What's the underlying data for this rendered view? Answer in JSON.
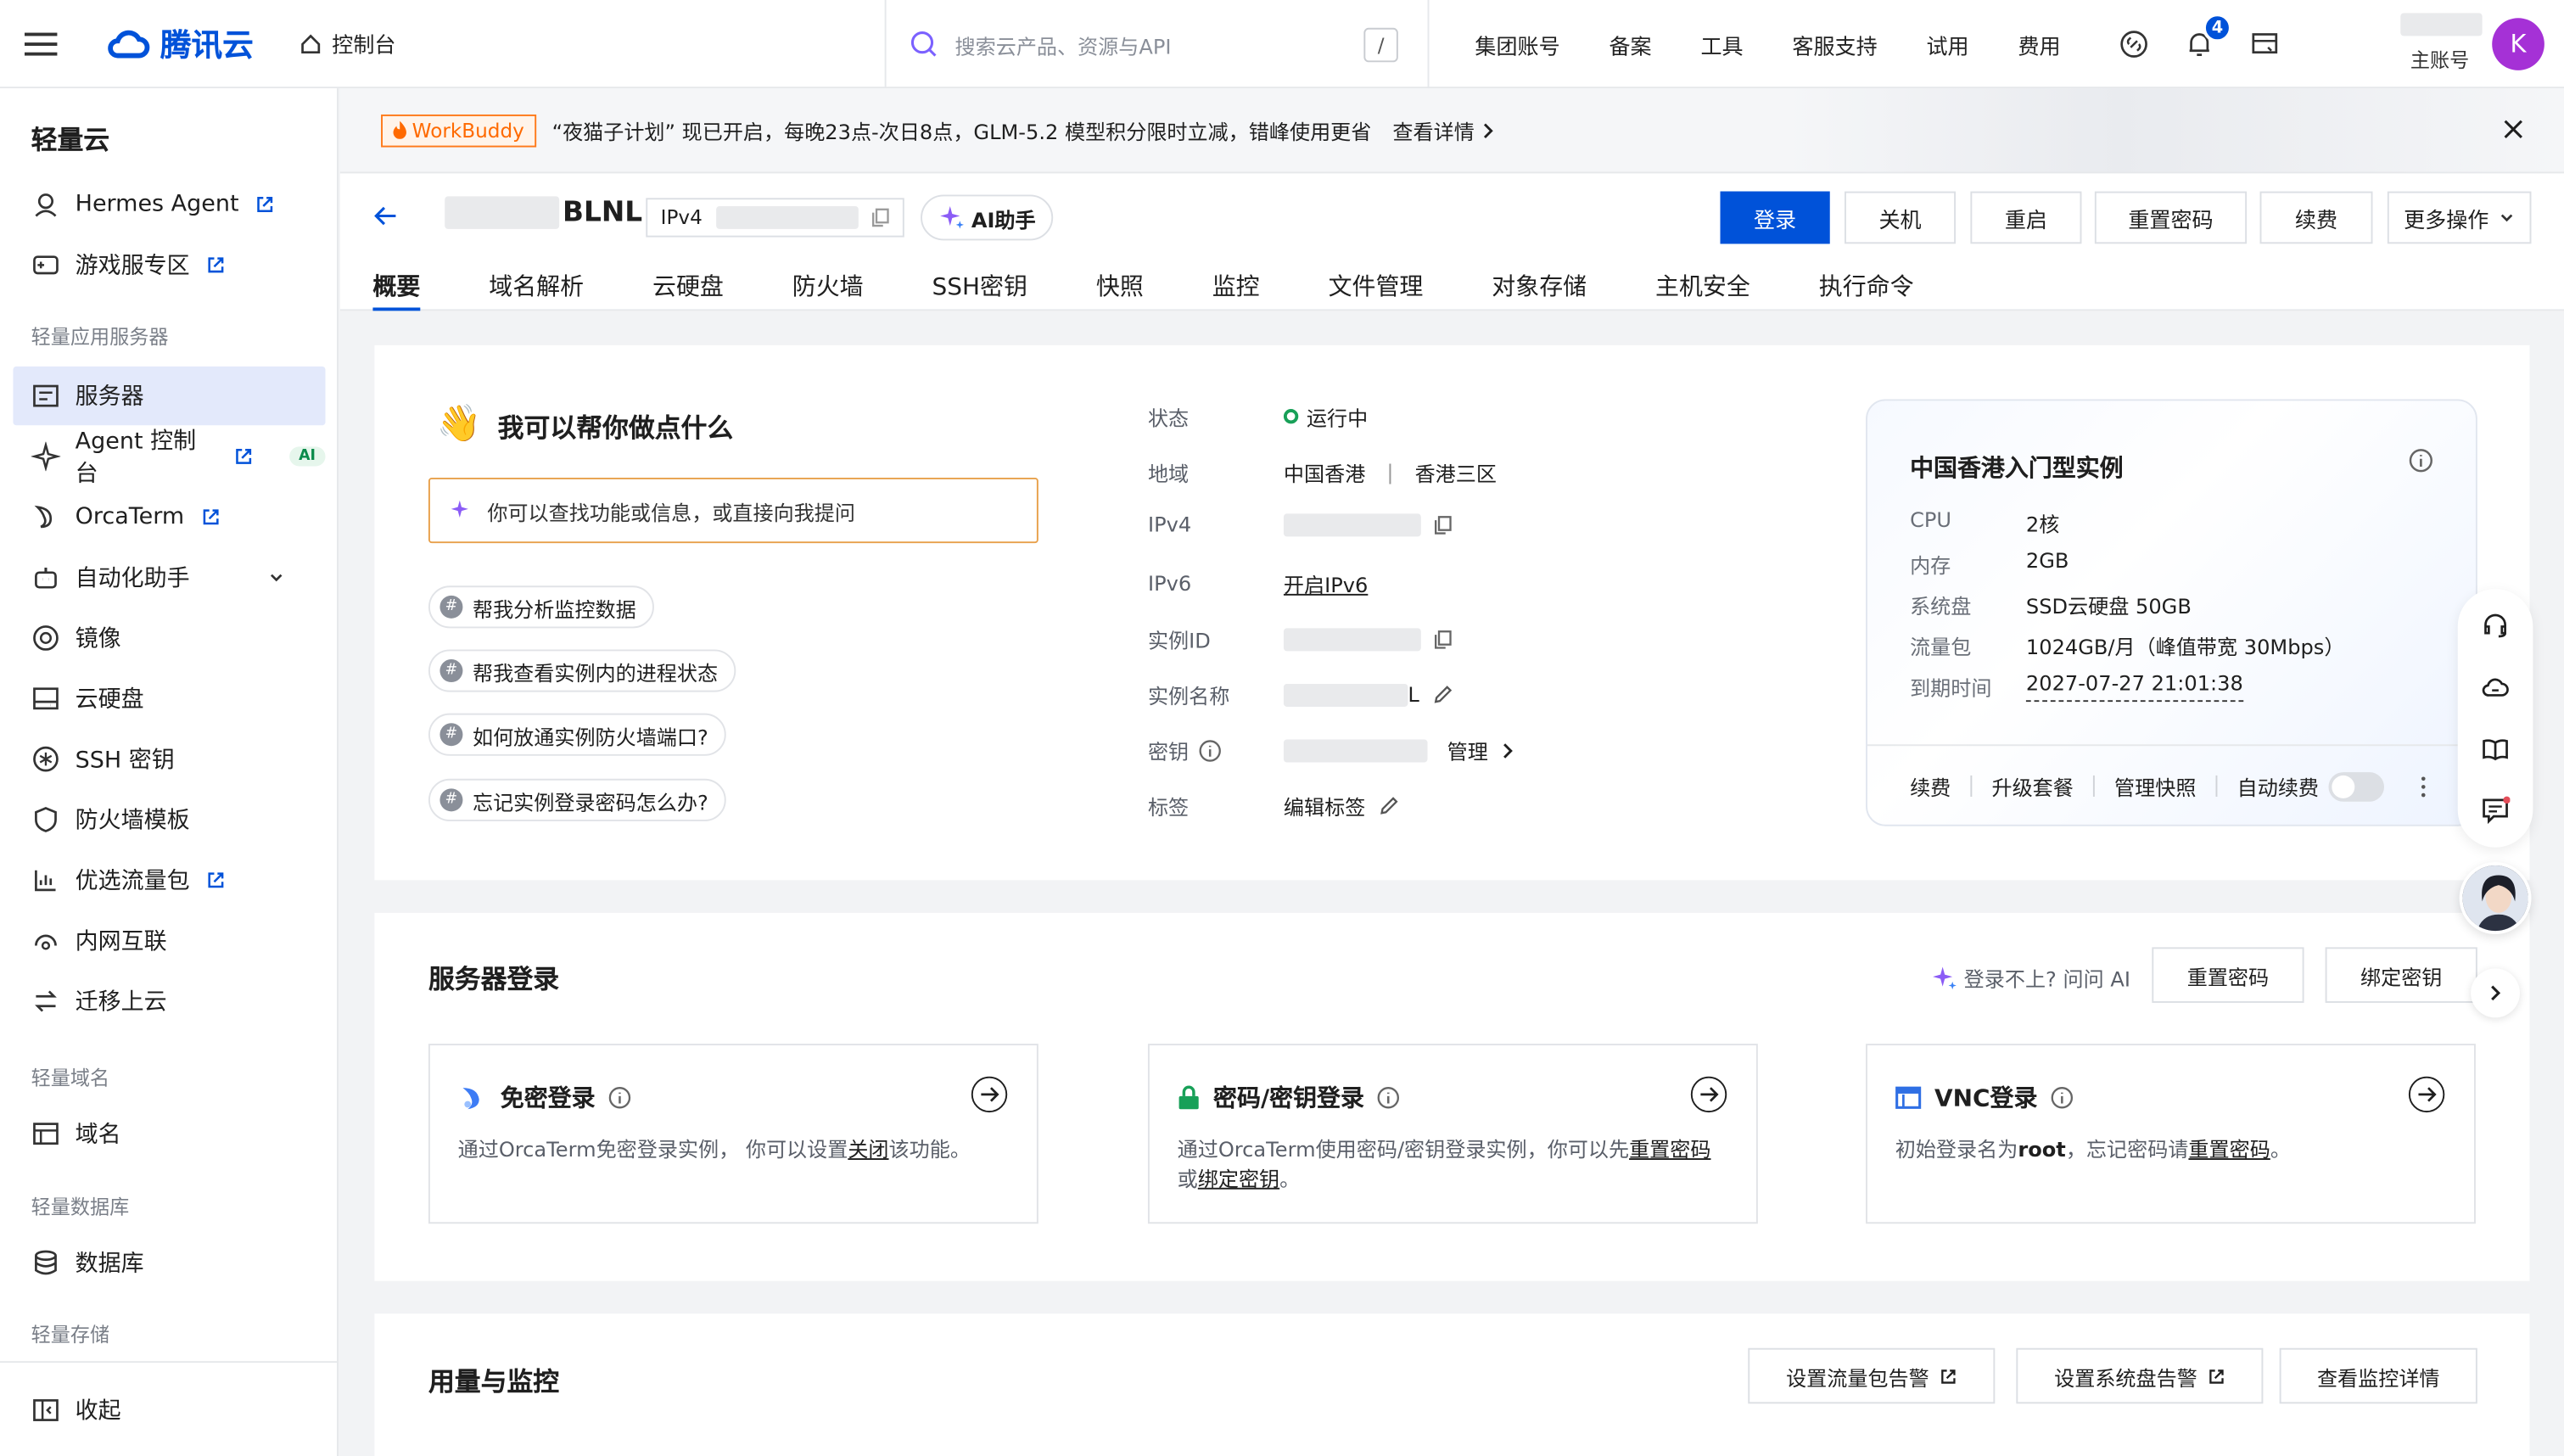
{
  "topbar": {
    "brand": "腾讯云",
    "console": "控制台",
    "search_placeholder": "搜索云产品、资源与API",
    "search_key": "/",
    "nav": [
      "集团账号",
      "备案",
      "工具",
      "客服支持",
      "试用",
      "费用"
    ],
    "notification_count": "4",
    "main_account": "主账号",
    "avatar_letter": "K"
  },
  "sidebar": {
    "title": "轻量云",
    "items_top": [
      {
        "label": "Hermes Agent",
        "icon": "agent-icon",
        "external": true
      },
      {
        "label": "游戏服专区",
        "icon": "gamepad-icon",
        "external": true
      }
    ],
    "section_app": "轻量应用服务器",
    "items_app": [
      {
        "label": "服务器",
        "icon": "server-icon",
        "active": true
      },
      {
        "label": "Agent 控制台",
        "icon": "sparkle-icon",
        "external": true,
        "tag": "AI"
      },
      {
        "label": "OrcaTerm",
        "icon": "orca-icon",
        "external": true
      },
      {
        "label": "自动化助手",
        "icon": "robot-icon",
        "expandable": true
      },
      {
        "label": "镜像",
        "icon": "image-icon"
      },
      {
        "label": "云硬盘",
        "icon": "disk-icon"
      },
      {
        "label": "SSH 密钥",
        "icon": "key-icon"
      },
      {
        "label": "防火墙模板",
        "icon": "shield-icon"
      },
      {
        "label": "优选流量包",
        "icon": "chart-icon",
        "external": true
      },
      {
        "label": "内网互联",
        "icon": "network-icon"
      },
      {
        "label": "迁移上云",
        "icon": "migrate-icon"
      }
    ],
    "section_domain": "轻量域名",
    "items_domain": [
      {
        "label": "域名",
        "icon": "domain-icon"
      }
    ],
    "section_db": "轻量数据库",
    "items_db": [
      {
        "label": "数据库",
        "icon": "database-icon"
      }
    ],
    "section_storage": "轻量存储",
    "collapse": "收起"
  },
  "banner": {
    "tag": "WorkBuddy",
    "text": "“夜猫子计划” 现已开启，每晚23点-次日8点，GLM-5.2 模型积分限时立减，错峰使用更省",
    "link": "查看详情"
  },
  "header": {
    "instance_suffix": "BLNL",
    "ip_type": "IPv4",
    "ai_assistant": "AI助手",
    "buttons": {
      "login": "登录",
      "shutdown": "关机",
      "restart": "重启",
      "reset_password": "重置密码",
      "renew": "续费",
      "more": "更多操作"
    },
    "tabs": [
      "概要",
      "域名解析",
      "云硬盘",
      "防火墙",
      "SSH密钥",
      "快照",
      "监控",
      "文件管理",
      "对象存储",
      "主机安全",
      "执行命令"
    ]
  },
  "overview": {
    "help_title": "我可以帮你做点什么",
    "help_placeholder": "你可以查找功能或信息，或直接向我提问",
    "suggestions": [
      "帮我分析监控数据",
      "帮我查看实例内的进程状态",
      "如何放通实例防火墙端口?",
      "忘记实例登录密码怎么办?"
    ],
    "info": {
      "status_label": "状态",
      "status_value": "运行中",
      "region_label": "地域",
      "region_value": "中国香港",
      "zone_value": "香港三区",
      "ipv4_label": "IPv4",
      "ipv6_label": "IPv6",
      "ipv6_action": "开启IPv6",
      "instance_id_label": "实例ID",
      "instance_name_label": "实例名称",
      "instance_name_tail": "L",
      "key_label": "密钥",
      "key_action": "管理",
      "tag_label": "标签",
      "tag_action": "编辑标签"
    },
    "spec": {
      "title": "中国香港入门型实例",
      "rows": [
        {
          "label": "CPU",
          "value": "2核"
        },
        {
          "label": "内存",
          "value": "2GB"
        },
        {
          "label": "系统盘",
          "value": "SSD云硬盘 50GB"
        },
        {
          "label": "流量包",
          "value": "1024GB/月（峰值带宽 30Mbps）"
        },
        {
          "label": "到期时间",
          "value": "2027-07-27 21:01:38"
        }
      ],
      "actions": [
        "续费",
        "升级套餐",
        "管理快照"
      ],
      "auto_renew": "自动续费"
    }
  },
  "server_login": {
    "title": "服务器登录",
    "ask_ai": "登录不上? 问问 AI",
    "reset_password": "重置密码",
    "bind_key": "绑定密钥",
    "boxes": [
      {
        "title": "免密登录",
        "desc_a": "通过OrcaTerm免密登录实例，  你可以设置",
        "desc_link": "关闭",
        "desc_b": "该功能。"
      },
      {
        "title": "密码/密钥登录",
        "desc_a": "通过OrcaTerm使用密码/密钥登录实例，你可以先",
        "desc_link": "重置密码",
        "desc_b": "或",
        "desc_link2": "绑定密钥",
        "desc_c": "。"
      },
      {
        "title": "VNC登录",
        "desc_a": "初始登录名为",
        "desc_bold": "root",
        "desc_b": "，忘记密码请",
        "desc_link": "重置密码",
        "desc_c": "。"
      }
    ]
  },
  "usage": {
    "title": "用量与监控",
    "btn_traffic_alarm": "设置流量包告警",
    "btn_system_alarm": "设置系统盘告警",
    "btn_monitor_detail": "查看监控详情"
  }
}
